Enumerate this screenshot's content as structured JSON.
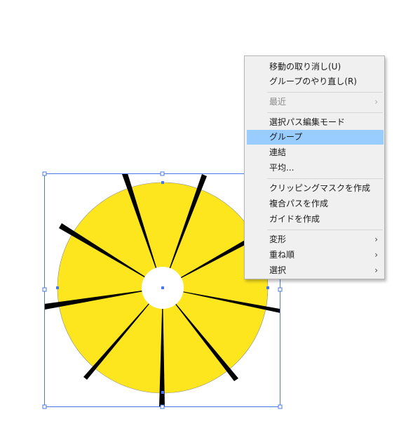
{
  "context_menu": {
    "items": [
      {
        "label": "移動の取り消し(U)",
        "submenu": false,
        "disabled": false,
        "highlighted": false
      },
      {
        "label": "グループのやり直し(R)",
        "submenu": false,
        "disabled": false,
        "highlighted": false
      },
      {
        "label": "最近",
        "submenu": true,
        "disabled": true,
        "highlighted": false
      },
      {
        "label": "選択パス編集モード",
        "submenu": false,
        "disabled": false,
        "highlighted": false
      },
      {
        "label": "グループ",
        "submenu": false,
        "disabled": false,
        "highlighted": true
      },
      {
        "label": "連結",
        "submenu": false,
        "disabled": false,
        "highlighted": false
      },
      {
        "label": "平均...",
        "submenu": false,
        "disabled": false,
        "highlighted": false
      },
      {
        "label": "クリッピングマスクを作成",
        "submenu": false,
        "disabled": false,
        "highlighted": false
      },
      {
        "label": "複合パスを作成",
        "submenu": false,
        "disabled": false,
        "highlighted": false
      },
      {
        "label": "ガイドを作成",
        "submenu": false,
        "disabled": false,
        "highlighted": false
      },
      {
        "label": "変形",
        "submenu": true,
        "disabled": false,
        "highlighted": false
      },
      {
        "label": "重ね順",
        "submenu": true,
        "disabled": false,
        "highlighted": false
      },
      {
        "label": "選択",
        "submenu": true,
        "disabled": false,
        "highlighted": false
      }
    ],
    "submenu_arrow": "›"
  },
  "artwork": {
    "fill_color": "#fde61e",
    "spoke_color": "#000000",
    "center_color": "#ffffff",
    "selection_color": "#4a78e8",
    "highlight_color": "#99ccff"
  }
}
